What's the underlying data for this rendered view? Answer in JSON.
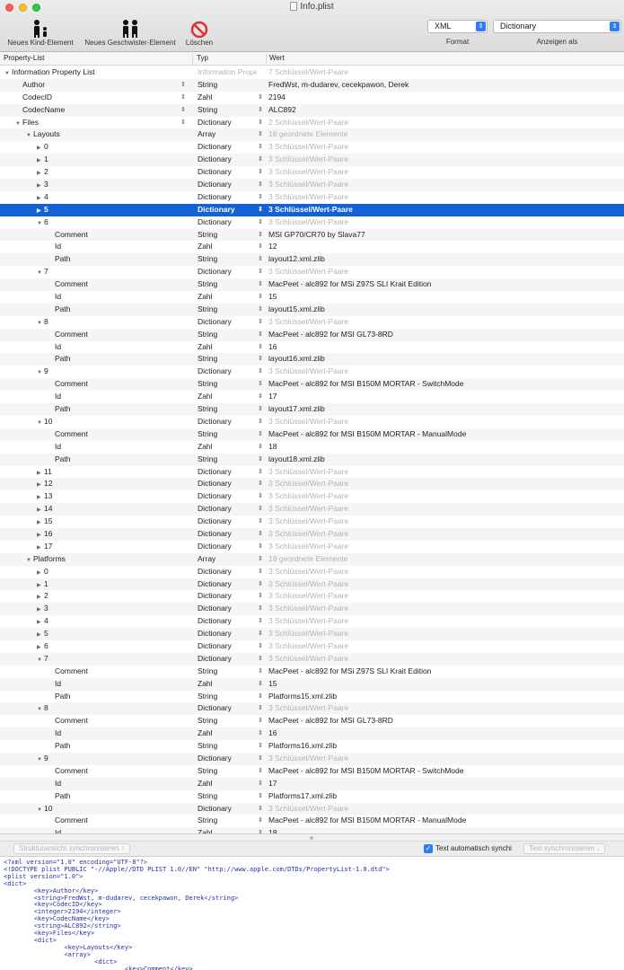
{
  "window": {
    "title": "Info.plist"
  },
  "toolbar": {
    "new_child": "Neues Kind-Element",
    "new_sibling": "Neues Geschwister-Element",
    "delete": "Löschen",
    "format_value": "XML",
    "format_caption": "Format",
    "view_value": "Dictionary",
    "view_caption": "Anzeigen als"
  },
  "columns": {
    "key": "Property-List",
    "type": "Typ",
    "value": "Wert"
  },
  "rows": [
    {
      "key": "Information Property List",
      "disc": "▼",
      "indent": 0,
      "type": "Information Propert...",
      "value": "7 Schlüssel/Wert-Paare",
      "muted_type": true,
      "muted": true
    },
    {
      "key": "Author",
      "disc": "",
      "indent": 1,
      "type": "String",
      "value": "FredWst, m-dudarev, cecekpawon, Derek",
      "stepper": true
    },
    {
      "key": "CodecID",
      "disc": "",
      "indent": 1,
      "type": "Zahl",
      "value": "2194",
      "stepper": true,
      "vstep": true
    },
    {
      "key": "CodecName",
      "disc": "",
      "indent": 1,
      "type": "String",
      "value": "ALC892",
      "stepper": true,
      "vstep": true
    },
    {
      "key": "Files",
      "disc": "▼",
      "indent": 1,
      "type": "Dictionary",
      "value": "2 Schlüssel/Wert-Paare",
      "stepper": true,
      "vstep": true,
      "muted": true
    },
    {
      "key": "Layouts",
      "disc": "▼",
      "indent": 2,
      "type": "Array",
      "value": "18 geordnete Elemente",
      "vstep": true,
      "muted": true
    },
    {
      "key": "0",
      "disc": "▶",
      "indent": 3,
      "type": "Dictionary",
      "value": "3 Schlüssel/Wert-Paare",
      "vstep": true,
      "muted": true
    },
    {
      "key": "1",
      "disc": "▶",
      "indent": 3,
      "type": "Dictionary",
      "value": "3 Schlüssel/Wert-Paare",
      "vstep": true,
      "muted": true
    },
    {
      "key": "2",
      "disc": "▶",
      "indent": 3,
      "type": "Dictionary",
      "value": "3 Schlüssel/Wert-Paare",
      "vstep": true,
      "muted": true
    },
    {
      "key": "3",
      "disc": "▶",
      "indent": 3,
      "type": "Dictionary",
      "value": "3 Schlüssel/Wert-Paare",
      "vstep": true,
      "muted": true
    },
    {
      "key": "4",
      "disc": "▶",
      "indent": 3,
      "type": "Dictionary",
      "value": "3 Schlüssel/Wert-Paare",
      "vstep": true,
      "muted": true
    },
    {
      "key": "5",
      "disc": "▶",
      "indent": 3,
      "type": "Dictionary",
      "value": "3 Schlüssel/Wert-Paare",
      "vstep": true,
      "selected": true
    },
    {
      "key": "6",
      "disc": "▼",
      "indent": 3,
      "type": "Dictionary",
      "value": "3 Schlüssel/Wert-Paare",
      "vstep": true,
      "muted": true
    },
    {
      "key": "Comment",
      "disc": "",
      "indent": 4,
      "type": "String",
      "value": "MSI GP70/CR70 by Slava77",
      "vstep": true
    },
    {
      "key": "Id",
      "disc": "",
      "indent": 4,
      "type": "Zahl",
      "value": "12",
      "vstep": true
    },
    {
      "key": "Path",
      "disc": "",
      "indent": 4,
      "type": "String",
      "value": "layout12.xml.zlib",
      "vstep": true
    },
    {
      "key": "7",
      "disc": "▼",
      "indent": 3,
      "type": "Dictionary",
      "value": "3 Schlüssel/Wert-Paare",
      "vstep": true,
      "muted": true
    },
    {
      "key": "Comment",
      "disc": "",
      "indent": 4,
      "type": "String",
      "value": "MacPeet - alc892 for MSi Z97S SLI Krait Edition",
      "vstep": true
    },
    {
      "key": "Id",
      "disc": "",
      "indent": 4,
      "type": "Zahl",
      "value": "15",
      "vstep": true
    },
    {
      "key": "Path",
      "disc": "",
      "indent": 4,
      "type": "String",
      "value": "layout15.xml.zlib",
      "vstep": true
    },
    {
      "key": "8",
      "disc": "▼",
      "indent": 3,
      "type": "Dictionary",
      "value": "3 Schlüssel/Wert-Paare",
      "vstep": true,
      "muted": true
    },
    {
      "key": "Comment",
      "disc": "",
      "indent": 4,
      "type": "String",
      "value": "MacPeet - alc892 for MSI GL73-8RD",
      "vstep": true
    },
    {
      "key": "Id",
      "disc": "",
      "indent": 4,
      "type": "Zahl",
      "value": "16",
      "vstep": true
    },
    {
      "key": "Path",
      "disc": "",
      "indent": 4,
      "type": "String",
      "value": "layout16.xml.zlib",
      "vstep": true
    },
    {
      "key": "9",
      "disc": "▼",
      "indent": 3,
      "type": "Dictionary",
      "value": "3 Schlüssel/Wert-Paare",
      "vstep": true,
      "muted": true
    },
    {
      "key": "Comment",
      "disc": "",
      "indent": 4,
      "type": "String",
      "value": "MacPeet - alc892 for MSI B150M MORTAR - SwitchMode",
      "vstep": true
    },
    {
      "key": "Id",
      "disc": "",
      "indent": 4,
      "type": "Zahl",
      "value": "17",
      "vstep": true
    },
    {
      "key": "Path",
      "disc": "",
      "indent": 4,
      "type": "String",
      "value": "layout17.xml.zlib",
      "vstep": true
    },
    {
      "key": "10",
      "disc": "▼",
      "indent": 3,
      "type": "Dictionary",
      "value": "3 Schlüssel/Wert-Paare",
      "vstep": true,
      "muted": true
    },
    {
      "key": "Comment",
      "disc": "",
      "indent": 4,
      "type": "String",
      "value": "MacPeet - alc892 for MSI B150M MORTAR - ManualMode",
      "vstep": true
    },
    {
      "key": "Id",
      "disc": "",
      "indent": 4,
      "type": "Zahl",
      "value": "18",
      "vstep": true
    },
    {
      "key": "Path",
      "disc": "",
      "indent": 4,
      "type": "String",
      "value": "layout18.xml.zlib",
      "vstep": true
    },
    {
      "key": "11",
      "disc": "▶",
      "indent": 3,
      "type": "Dictionary",
      "value": "3 Schlüssel/Wert-Paare",
      "vstep": true,
      "muted": true
    },
    {
      "key": "12",
      "disc": "▶",
      "indent": 3,
      "type": "Dictionary",
      "value": "3 Schlüssel/Wert-Paare",
      "vstep": true,
      "muted": true
    },
    {
      "key": "13",
      "disc": "▶",
      "indent": 3,
      "type": "Dictionary",
      "value": "3 Schlüssel/Wert-Paare",
      "vstep": true,
      "muted": true
    },
    {
      "key": "14",
      "disc": "▶",
      "indent": 3,
      "type": "Dictionary",
      "value": "3 Schlüssel/Wert-Paare",
      "vstep": true,
      "muted": true
    },
    {
      "key": "15",
      "disc": "▶",
      "indent": 3,
      "type": "Dictionary",
      "value": "3 Schlüssel/Wert-Paare",
      "vstep": true,
      "muted": true
    },
    {
      "key": "16",
      "disc": "▶",
      "indent": 3,
      "type": "Dictionary",
      "value": "3 Schlüssel/Wert-Paare",
      "vstep": true,
      "muted": true
    },
    {
      "key": "17",
      "disc": "▶",
      "indent": 3,
      "type": "Dictionary",
      "value": "3 Schlüssel/Wert-Paare",
      "vstep": true,
      "muted": true
    },
    {
      "key": "Platforms",
      "disc": "▼",
      "indent": 2,
      "type": "Array",
      "value": "18 geordnete Elemente",
      "vstep": true,
      "muted": true
    },
    {
      "key": "0",
      "disc": "▶",
      "indent": 3,
      "type": "Dictionary",
      "value": "3 Schlüssel/Wert-Paare",
      "vstep": true,
      "muted": true
    },
    {
      "key": "1",
      "disc": "▶",
      "indent": 3,
      "type": "Dictionary",
      "value": "3 Schlüssel/Wert-Paare",
      "vstep": true,
      "muted": true
    },
    {
      "key": "2",
      "disc": "▶",
      "indent": 3,
      "type": "Dictionary",
      "value": "3 Schlüssel/Wert-Paare",
      "vstep": true,
      "muted": true
    },
    {
      "key": "3",
      "disc": "▶",
      "indent": 3,
      "type": "Dictionary",
      "value": "3 Schlüssel/Wert-Paare",
      "vstep": true,
      "muted": true
    },
    {
      "key": "4",
      "disc": "▶",
      "indent": 3,
      "type": "Dictionary",
      "value": "3 Schlüssel/Wert-Paare",
      "vstep": true,
      "muted": true
    },
    {
      "key": "5",
      "disc": "▶",
      "indent": 3,
      "type": "Dictionary",
      "value": "3 Schlüssel/Wert-Paare",
      "vstep": true,
      "muted": true
    },
    {
      "key": "6",
      "disc": "▶",
      "indent": 3,
      "type": "Dictionary",
      "value": "3 Schlüssel/Wert-Paare",
      "vstep": true,
      "muted": true
    },
    {
      "key": "7",
      "disc": "▼",
      "indent": 3,
      "type": "Dictionary",
      "value": "3 Schlüssel/Wert-Paare",
      "vstep": true,
      "muted": true
    },
    {
      "key": "Comment",
      "disc": "",
      "indent": 4,
      "type": "String",
      "value": "MacPeet - alc892 for MSi Z97S SLI Krait Edition",
      "vstep": true
    },
    {
      "key": "Id",
      "disc": "",
      "indent": 4,
      "type": "Zahl",
      "value": "15",
      "vstep": true
    },
    {
      "key": "Path",
      "disc": "",
      "indent": 4,
      "type": "String",
      "value": "Platforms15.xml.zlib",
      "vstep": true
    },
    {
      "key": "8",
      "disc": "▼",
      "indent": 3,
      "type": "Dictionary",
      "value": "3 Schlüssel/Wert-Paare",
      "vstep": true,
      "muted": true
    },
    {
      "key": "Comment",
      "disc": "",
      "indent": 4,
      "type": "String",
      "value": "MacPeet - alc892 for MSI GL73-8RD",
      "vstep": true
    },
    {
      "key": "Id",
      "disc": "",
      "indent": 4,
      "type": "Zahl",
      "value": "16",
      "vstep": true
    },
    {
      "key": "Path",
      "disc": "",
      "indent": 4,
      "type": "String",
      "value": "Platforms16.xml.zlib",
      "vstep": true
    },
    {
      "key": "9",
      "disc": "▼",
      "indent": 3,
      "type": "Dictionary",
      "value": "3 Schlüssel/Wert-Paare",
      "vstep": true,
      "muted": true
    },
    {
      "key": "Comment",
      "disc": "",
      "indent": 4,
      "type": "String",
      "value": "MacPeet - alc892 for MSI B150M MORTAR - SwitchMode",
      "vstep": true
    },
    {
      "key": "Id",
      "disc": "",
      "indent": 4,
      "type": "Zahl",
      "value": "17",
      "vstep": true
    },
    {
      "key": "Path",
      "disc": "",
      "indent": 4,
      "type": "String",
      "value": "Platforms17.xml.zlib",
      "vstep": true
    },
    {
      "key": "10",
      "disc": "▼",
      "indent": 3,
      "type": "Dictionary",
      "value": "3 Schlüssel/Wert-Paare",
      "vstep": true,
      "muted": true
    },
    {
      "key": "Comment",
      "disc": "",
      "indent": 4,
      "type": "String",
      "value": "MacPeet - alc892 for MSI B150M MORTAR - ManualMode",
      "vstep": true
    },
    {
      "key": "Id",
      "disc": "",
      "indent": 4,
      "type": "Zahl",
      "value": "18",
      "vstep": true
    }
  ],
  "bottom": {
    "sync_structure": "Strukturansicht synchronisieren ↑",
    "auto_sync": "Text automatisch synchi",
    "sync_text": "Text synchronisieren ↓"
  },
  "xml_lines": [
    "<?xml version=\"1.0\" encoding=\"UTF-8\"?>",
    "<!DOCTYPE plist PUBLIC \"-//Apple//DTD PLIST 1.0//EN\" \"http://www.apple.com/DTDs/PropertyList-1.0.dtd\">",
    "<plist version=\"1.0\">",
    "<dict>",
    "        <key>Author</key>",
    "        <string>FredWst, m-dudarev, cecekpawon, Derek</string>",
    "        <key>CodecID</key>",
    "        <integer>2194</integer>",
    "        <key>CodecName</key>",
    "        <string>ALC892</string>",
    "        <key>Files</key>",
    "        <dict>",
    "                <key>Layouts</key>",
    "                <array>",
    "                        <dict>",
    "                                <key>Comment</key>"
  ],
  "colors": {
    "selection": "#1361d6",
    "accent": "#2f7df6",
    "xml_tag": "#2431a8"
  },
  "icons": {
    "new_child": "child-node-icon",
    "new_sibling": "sibling-node-icon",
    "delete": "delete-icon"
  }
}
